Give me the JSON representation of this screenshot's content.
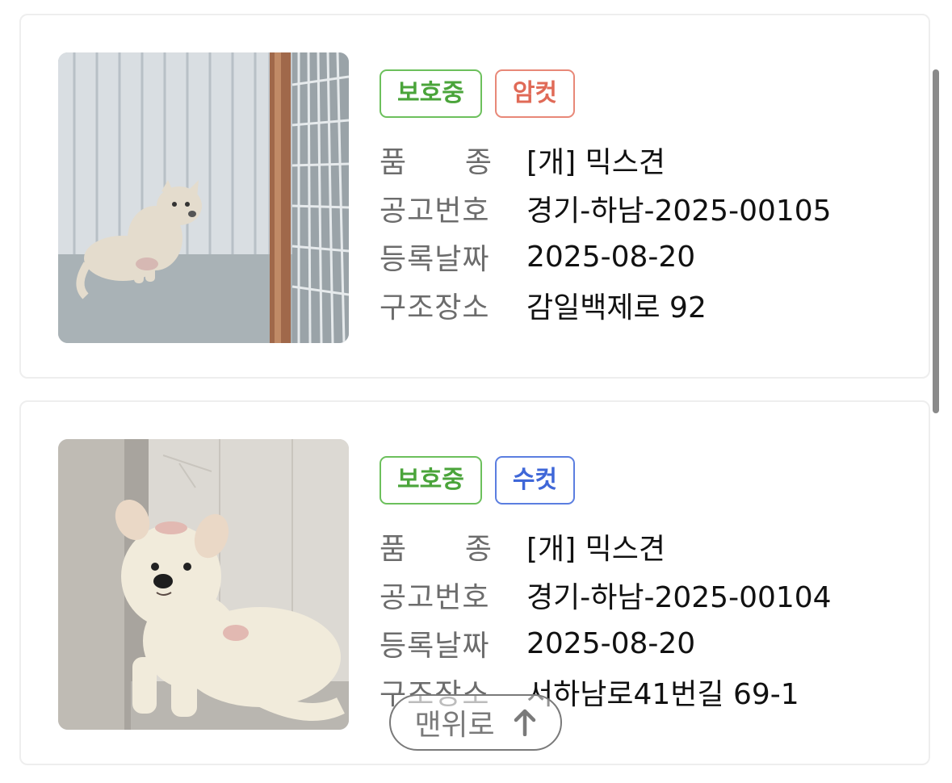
{
  "labels": {
    "breed_left": "품",
    "breed_right": "종",
    "notice_no": "공고번호",
    "reg_date": "등록날짜",
    "rescue_place": "구조장소"
  },
  "cards": [
    {
      "status": "보호중",
      "sex": "암컷",
      "breed": "[개] 믹스견",
      "notice_no": "경기-하남-2025-00105",
      "reg_date": "2025-08-20",
      "rescue_place": "감일백제로 92"
    },
    {
      "status": "보호중",
      "sex": "수컷",
      "breed": "[개] 믹스견",
      "notice_no": "경기-하남-2025-00104",
      "reg_date": "2025-08-20",
      "rescue_place": "서하남로41번길 69-1"
    }
  ],
  "scroll_top_button": {
    "label": "맨위로",
    "icon": "arrow-up-icon"
  },
  "colors": {
    "status_green": "#4aa43a",
    "female_red": "#e06a57",
    "male_blue": "#3f67d8"
  }
}
